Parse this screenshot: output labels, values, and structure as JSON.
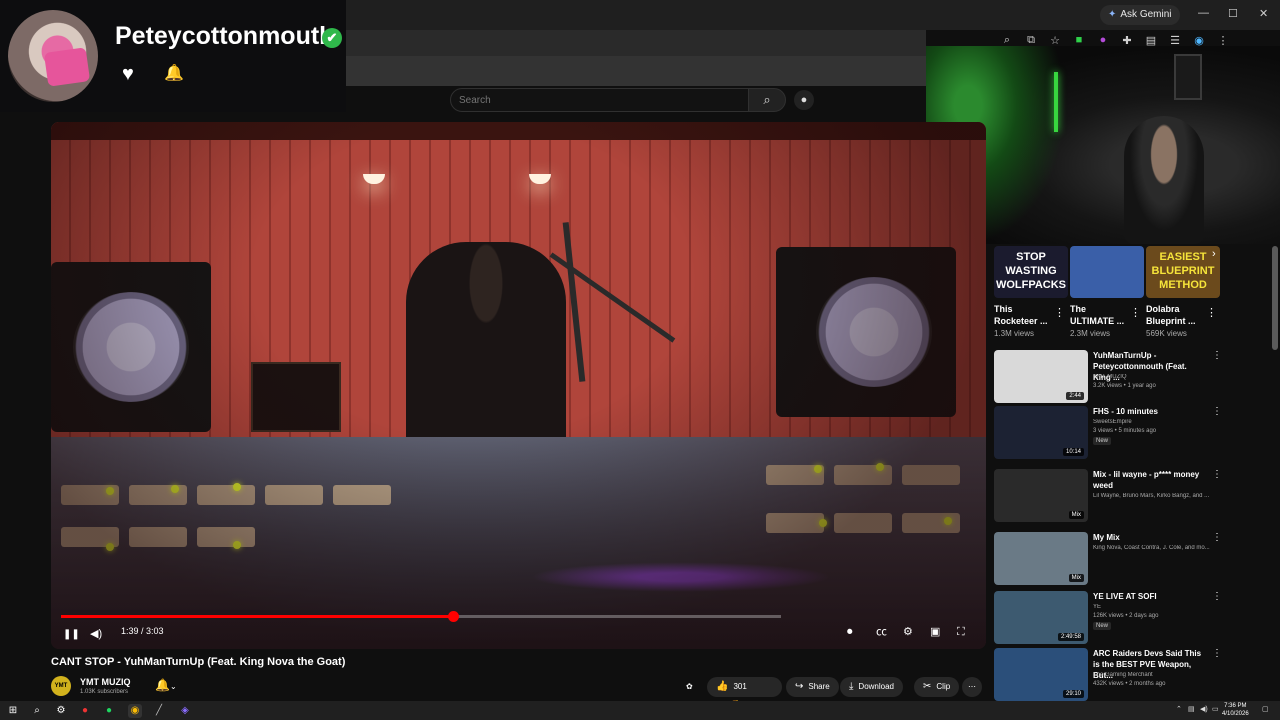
{
  "streamer": {
    "name": "Peteycottonmouth",
    "verified_glyph": "✔",
    "heart_icon": "heart-icon",
    "bell_icon": "bell-icon"
  },
  "browser": {
    "gemini_label": "Ask Gemini",
    "window_controls": [
      "—",
      "☐",
      "✕"
    ],
    "toolbar_icons": [
      "zoom-icon",
      "install-icon",
      "star-icon",
      "extension-green-icon",
      "extension-purple-icon",
      "puzzle-icon",
      "sidepanel-icon",
      "tabs-icon",
      "profile-icon",
      "menu-icon"
    ]
  },
  "search": {
    "placeholder": "Search",
    "search_glyph": "⌕",
    "mic_glyph": "🎙"
  },
  "player": {
    "time": "1:39 / 3:03",
    "progress_fraction": 0.545,
    "buffered_fraction": 1.0,
    "pause_glyph": "❚❚",
    "volume_glyph": "🔊"
  },
  "video": {
    "title": "CANT STOP - YuhManTurnUp (Feat. King Nova the Goat)",
    "channel_name": "YMT MUZIQ",
    "channel_subs": "1.03K subscribers",
    "channel_avatar_text": "YMT",
    "likes": "301",
    "share_label": "Share",
    "download_label": "Download",
    "clip_label": "Clip"
  },
  "shorts": [
    {
      "thumb_text": "STOP WASTING WOLFPACKS",
      "title": "This Rocketeer ...",
      "views": "1.3M views",
      "bg": "#1b1b2e",
      "fg": "#ffffff"
    },
    {
      "thumb_text": "",
      "title": "The ULTIMATE ...",
      "views": "2.3M views",
      "bg": "#3a5fa8",
      "fg": "#f2c744"
    },
    {
      "thumb_text": "EASIEST BLUEPRINT METHOD",
      "title": "Dolabra Blueprint ...",
      "views": "569K views",
      "bg": "#6b4a1c",
      "fg": "#f6e43a"
    }
  ],
  "recommended": [
    {
      "title": "YuhManTurnUp - Peteycottonmouth (Feat. King ...",
      "channel": "YMT MUZIQ",
      "meta": "3.2K views • 1 year ago",
      "duration": "2:44",
      "badge": "",
      "thumb_bg": "#d9d9d9"
    },
    {
      "title": "FHS - 10 minutes",
      "channel": "SweetsEmpire",
      "meta": "3 views • 5 minutes ago",
      "duration": "10:14",
      "badge": "New",
      "thumb_bg": "#1c2233"
    },
    {
      "title": "Mix - lil wayne - p**** money weed",
      "channel": "Lil Wayne, Bruno Mars, Kirko Bangz, and ...",
      "meta": "",
      "duration": "Mix",
      "badge": "",
      "thumb_bg": "#2a2a2a"
    },
    {
      "title": "My Mix",
      "channel": "King Nova, Coast Contra, J. Cole, and mo...",
      "meta": "",
      "duration": "Mix",
      "badge": "",
      "thumb_bg": "#6a7a86"
    },
    {
      "title": "YE LIVE AT SOFI",
      "channel": "YE",
      "meta": "126K views • 2 days ago",
      "duration": "2:49:58",
      "badge": "New",
      "thumb_bg": "#3d5a70"
    },
    {
      "title": "ARC Raiders Devs Said This is the BEST PVE Weapon, But...",
      "channel": "The Gaming Merchant",
      "meta": "432K views • 2 months ago",
      "duration": "29:10",
      "badge": "",
      "thumb_bg": "#2b4f7a"
    }
  ],
  "taskbar": {
    "time": "7:36 PM",
    "date": "4/10/2026",
    "apps": [
      "windows-icon",
      "search-icon",
      "app-icon",
      "app-icon",
      "spotify-icon",
      "chrome-icon",
      "app-icon",
      "app-icon"
    ]
  }
}
